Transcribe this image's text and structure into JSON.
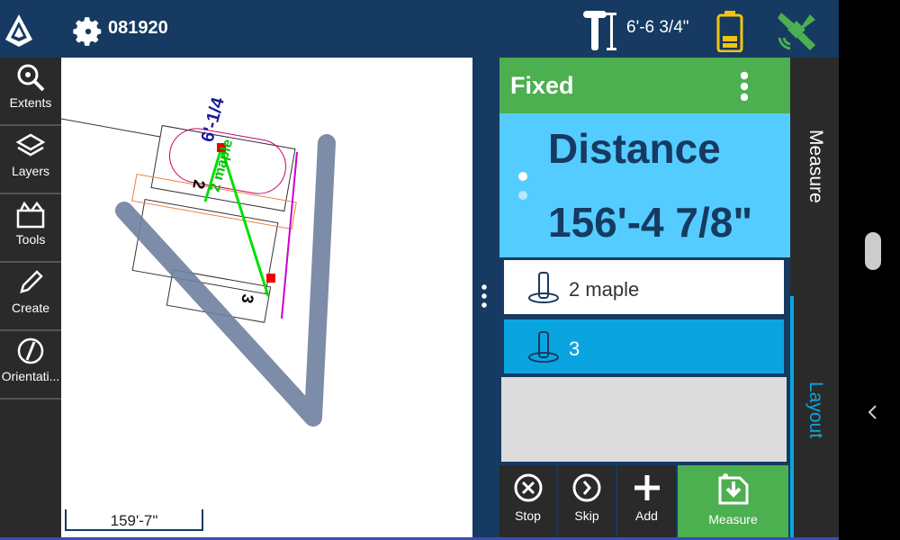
{
  "topbar": {
    "job_name": "081920",
    "antenna_height": "6'-6 3/4\"",
    "colors": {
      "bg": "#163a61",
      "battery": "#f1c40f",
      "satellite": "#4caf50"
    }
  },
  "sidebar": {
    "items": [
      {
        "label": "Extents",
        "icon": "zoom-extents-icon"
      },
      {
        "label": "Layers",
        "icon": "layers-icon"
      },
      {
        "label": "Tools",
        "icon": "tools-icon"
      },
      {
        "label": "Create",
        "icon": "pencil-icon"
      },
      {
        "label": "Orientati...",
        "icon": "compass-icon"
      }
    ]
  },
  "map": {
    "scale_label": "159'-7\"",
    "labels": {
      "point_2": "2",
      "point_3": "3",
      "line_label": "2 maple",
      "dim_label": "6'-1/4"
    }
  },
  "panel": {
    "status": "Fixed",
    "measure_label": "Distance",
    "measure_value": "156'-4 7/8\"",
    "points": [
      {
        "name": "2 maple",
        "selected": false
      },
      {
        "name": "3",
        "selected": true
      }
    ],
    "actions": [
      {
        "label": "Stop",
        "icon": "stop-icon"
      },
      {
        "label": "Skip",
        "icon": "skip-icon"
      },
      {
        "label": "Add",
        "icon": "plus-icon"
      },
      {
        "label": "Measure",
        "icon": "measure-icon"
      }
    ]
  },
  "tabs": {
    "measure": "Measure",
    "layout": "Layout"
  }
}
